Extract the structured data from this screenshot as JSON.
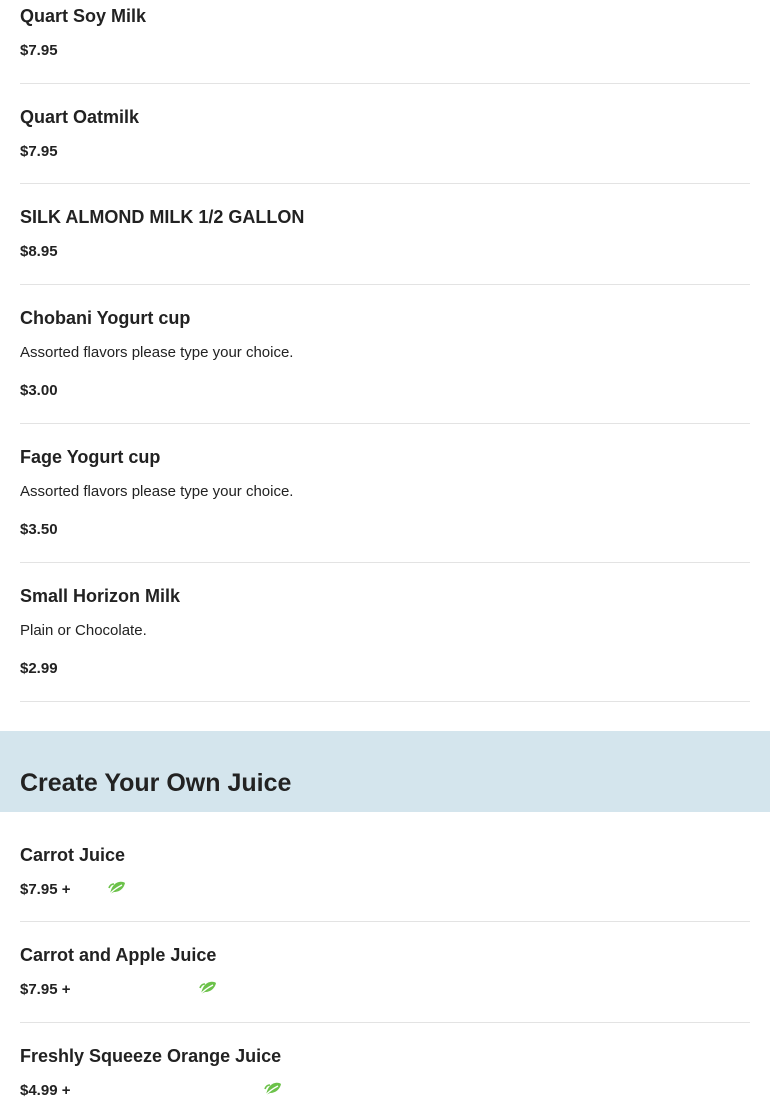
{
  "menu_items_top": [
    {
      "name": "Quart Soy Milk",
      "description": "",
      "price": "$7.95"
    },
    {
      "name": "Quart Oatmilk",
      "description": "",
      "price": "$7.95"
    },
    {
      "name": "SILK ALMOND MILK 1/2 GALLON",
      "description": "",
      "price": "$8.95"
    },
    {
      "name": "Chobani Yogurt cup",
      "description": "Assorted flavors please type your choice.",
      "price": "$3.00"
    },
    {
      "name": "Fage Yogurt cup",
      "description": "Assorted flavors please type your choice.",
      "price": "$3.50"
    },
    {
      "name": "Small Horizon Milk",
      "description": "Plain or Chocolate.",
      "price": "$2.99"
    }
  ],
  "section": {
    "title": "Create Your Own Juice",
    "background_color": "#d4e5ed",
    "items": [
      {
        "name": "Carrot Juice",
        "price": "$7.95 +",
        "icon": "leaf-icon"
      },
      {
        "name": "Carrot and Apple Juice",
        "price": "$7.95 +",
        "icon": "leaf-icon"
      },
      {
        "name": "Freshly Squeeze Orange Juice",
        "price": "$4.99 +",
        "icon": "leaf-icon"
      }
    ]
  },
  "colors": {
    "text": "#222222",
    "divider": "#e3e3e3",
    "leaf_icon": "#6cc24a"
  }
}
